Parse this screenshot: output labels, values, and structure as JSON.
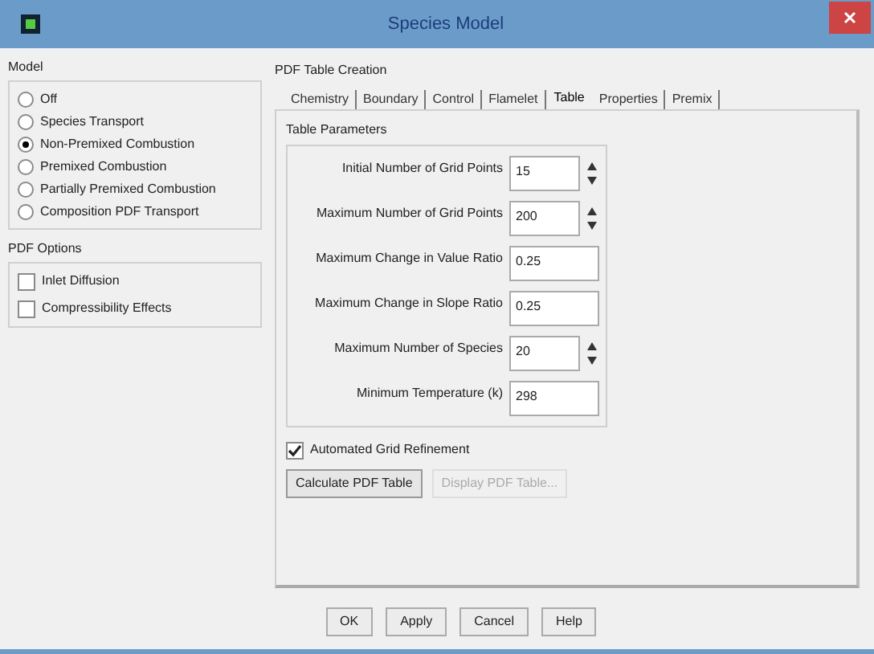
{
  "window": {
    "title": "Species Model"
  },
  "model": {
    "title": "Model",
    "options": [
      {
        "label": "Off",
        "selected": false
      },
      {
        "label": "Species Transport",
        "selected": false
      },
      {
        "label": "Non-Premixed Combustion",
        "selected": true
      },
      {
        "label": "Premixed Combustion",
        "selected": false
      },
      {
        "label": "Partially Premixed Combustion",
        "selected": false
      },
      {
        "label": "Composition PDF Transport",
        "selected": false
      }
    ]
  },
  "pdf_options": {
    "title": "PDF Options",
    "options": [
      {
        "label": "Inlet Diffusion",
        "checked": false
      },
      {
        "label": "Compressibility Effects",
        "checked": false
      }
    ]
  },
  "pdf_table_creation": {
    "title": "PDF Table Creation",
    "tabs": [
      {
        "label": "Chemistry",
        "selected": false
      },
      {
        "label": "Boundary",
        "selected": false
      },
      {
        "label": "Control",
        "selected": false
      },
      {
        "label": "Flamelet",
        "selected": false
      },
      {
        "label": "Table",
        "selected": true
      },
      {
        "label": "Properties",
        "selected": false
      },
      {
        "label": "Premix",
        "selected": false
      }
    ],
    "table_parameters": {
      "title": "Table Parameters",
      "fields": [
        {
          "label": "Initial Number of Grid Points",
          "value": "15",
          "kind": "spinner"
        },
        {
          "label": "Maximum Number of Grid Points",
          "value": "200",
          "kind": "spinner"
        },
        {
          "label": "Maximum Change in Value Ratio",
          "value": "0.25",
          "kind": "text"
        },
        {
          "label": "Maximum Change in Slope Ratio",
          "value": "0.25",
          "kind": "text"
        },
        {
          "label": "Maximum Number of Species",
          "value": "20",
          "kind": "spinner"
        },
        {
          "label": "Minimum Temperature (k)",
          "value": "298",
          "kind": "text"
        }
      ]
    },
    "automated_grid_refinement": {
      "label": "Automated Grid Refinement",
      "checked": true
    },
    "buttons": [
      {
        "label": "Calculate PDF Table",
        "disabled": false
      },
      {
        "label": "Display PDF Table...",
        "disabled": true
      }
    ]
  },
  "footer_buttons": [
    "OK",
    "Apply",
    "Cancel",
    "Help"
  ]
}
